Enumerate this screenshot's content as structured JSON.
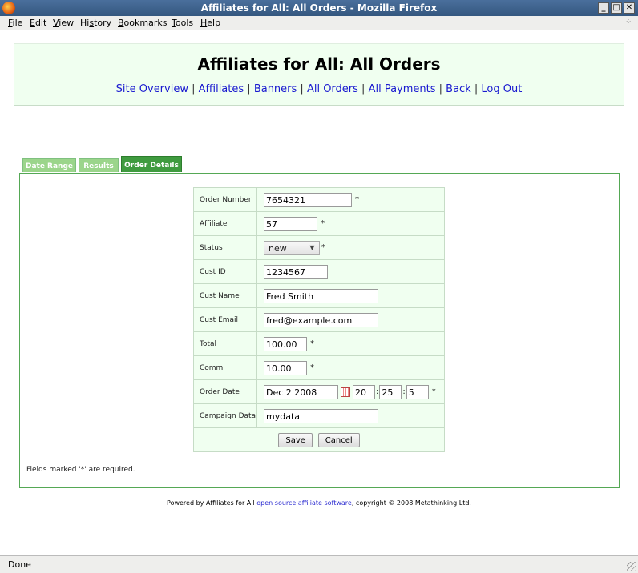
{
  "window": {
    "title": "Affiliates for All: All Orders - Mozilla Firefox"
  },
  "menu": [
    "File",
    "Edit",
    "View",
    "History",
    "Bookmarks",
    "Tools",
    "Help"
  ],
  "menu_underline": [
    "F",
    "E",
    "V",
    "s",
    "B",
    "T",
    "H"
  ],
  "header": {
    "title": "Affiliates for All: All Orders",
    "nav": [
      "Site Overview",
      "Affiliates",
      "Banners",
      "All Orders",
      "All Payments",
      "Back",
      "Log Out"
    ]
  },
  "tabs": [
    "Date Range",
    "Results",
    "Order Details"
  ],
  "form": {
    "order_number": {
      "label": "Order Number",
      "value": "7654321",
      "required": "*"
    },
    "affiliate": {
      "label": "Affiliate",
      "value": "57",
      "required": "*"
    },
    "status": {
      "label": "Status",
      "value": "new",
      "required": "*"
    },
    "cust_id": {
      "label": "Cust ID",
      "value": "1234567"
    },
    "cust_name": {
      "label": "Cust Name",
      "value": "Fred Smith"
    },
    "cust_email": {
      "label": "Cust Email",
      "value": "fred@example.com"
    },
    "total": {
      "label": "Total",
      "value": "100.00",
      "required": "*"
    },
    "comm": {
      "label": "Comm",
      "value": "10.00",
      "required": "*"
    },
    "order_date": {
      "label": "Order Date",
      "date": "Dec 2 2008",
      "hour": "20",
      "minute": "25",
      "second": "5",
      "required": "*"
    },
    "campaign_data": {
      "label": "Campaign Data",
      "value": "mydata"
    },
    "save_label": "Save",
    "cancel_label": "Cancel"
  },
  "required_note": "Fields marked '*' are required.",
  "footer": {
    "prefix": "Powered by Affiliates for All ",
    "link": "open source affiliate software",
    "suffix": ", copyright © 2008 Metathinking Ltd."
  },
  "status_bar": "Done",
  "colors": {
    "tab_active": "#3f9b3f",
    "tab_inactive": "#9bd58b",
    "panel_border": "#55a855",
    "header_bg": "#f0fff0",
    "link": "#1a1ad0"
  }
}
